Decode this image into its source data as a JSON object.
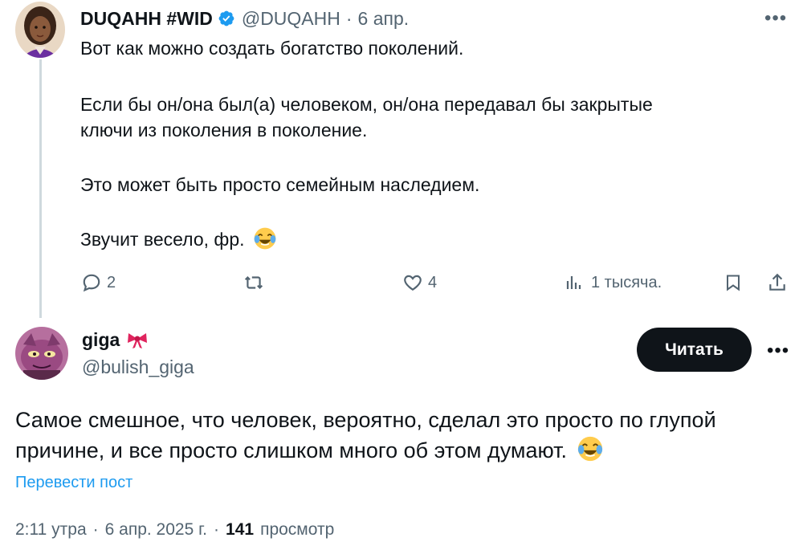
{
  "parent_tweet": {
    "author_name": "DUQAHH #WID",
    "handle": "@DUQAHH",
    "separator": "·",
    "date": "6 апр.",
    "more_icon": "more-horizontal-icon",
    "text_lines": [
      "Вот как можно создать богатство поколений.",
      "Если бы он/она был(а) человеком, он/она передавал бы закрытые",
      "ключи из поколения в поколение.",
      "Это может быть просто семейным наследием.",
      "Звучит весело, фр."
    ],
    "actions": {
      "reply_count": "2",
      "like_count": "4",
      "views_label": "1 тысяча."
    }
  },
  "reply_tweet": {
    "author_name": "giga",
    "handle": "@bulish_giga",
    "follow_label": "Читать",
    "text_lines": [
      "Самое смешное, что человек, вероятно, сделал это просто по глупой",
      "причине, и все просто слишком много об этом думают."
    ],
    "translate_label": "Перевести пост",
    "meta": {
      "time": "2:11 утра",
      "date": "6 апр. 2025 г.",
      "separator": "·",
      "views_count": "141",
      "views_label": "просмотр"
    }
  },
  "colors": {
    "text_primary": "#0f1419",
    "text_secondary": "#536471",
    "accent": "#1d9bf0",
    "verified": "#1d9bf0",
    "thread_line": "#cfd9de",
    "button_bg": "#0f1419"
  }
}
